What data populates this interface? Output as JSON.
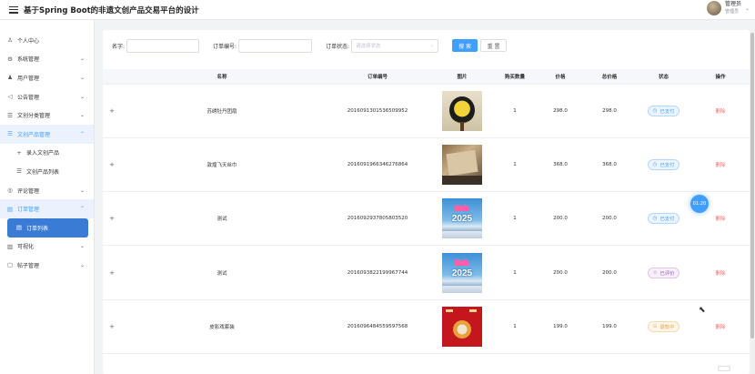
{
  "header": {
    "title": "基于Spring Boot的非遗文创产品交易平台的设计",
    "user_name": "管理员",
    "user_role": "管理员",
    "menu_icon": "hamburger-icon",
    "caret_icon": "chevron-down-icon"
  },
  "sidebar": {
    "items": [
      {
        "label": "个人中心",
        "icon": "user-icon",
        "glyph": "♙",
        "caret": ""
      },
      {
        "label": "系统管理",
        "icon": "gear-icon",
        "glyph": "⚙",
        "caret": "⌄"
      },
      {
        "label": "用户管理",
        "icon": "users-icon",
        "glyph": "♟",
        "caret": "⌄"
      },
      {
        "label": "公告管理",
        "icon": "megaphone-icon",
        "glyph": "◁",
        "caret": "⌄"
      },
      {
        "label": "文创分类管理",
        "icon": "list-icon",
        "glyph": "☰",
        "caret": "⌄"
      },
      {
        "label": "文创产品管理",
        "icon": "list-icon",
        "glyph": "☰",
        "caret": "⌃",
        "open": true
      },
      {
        "label": "录入文创产品",
        "icon": "plus-icon",
        "glyph": "+",
        "caret": "",
        "sub": true
      },
      {
        "label": "文创产品列表",
        "icon": "list-icon",
        "glyph": "☰",
        "caret": "",
        "sub": true
      },
      {
        "label": "评论管理",
        "icon": "comment-icon",
        "glyph": "◎",
        "caret": "⌄"
      },
      {
        "label": "订单管理",
        "icon": "document-icon",
        "glyph": "▤",
        "caret": "⌃",
        "open": true
      },
      {
        "label": "订单列表",
        "icon": "document-icon",
        "glyph": "▤",
        "caret": "",
        "sub": true,
        "active": true
      },
      {
        "label": "可视化",
        "icon": "chart-icon",
        "glyph": "▥",
        "caret": "⌄"
      },
      {
        "label": "帖子管理",
        "icon": "post-icon",
        "glyph": "▢",
        "caret": "⌄"
      }
    ]
  },
  "search": {
    "name_label": "名字:",
    "name_value": "",
    "order_no_label": "订单编号:",
    "order_no_value": "",
    "status_label": "订单状态:",
    "status_placeholder": "请选择状态",
    "search_button": "搜 索",
    "reset_button": "重 置"
  },
  "table": {
    "columns": [
      "",
      "名称",
      "订单编号",
      "图片",
      "购买数量",
      "价格",
      "总价格",
      "状态",
      "操作"
    ],
    "rows": [
      {
        "expand": "+",
        "name": "苏绣牡丹团扇",
        "order_no": "2016091301536509952",
        "image": "fan-photo",
        "qty": "1",
        "price": "298.0",
        "total": "298.0",
        "status": "已支付",
        "status_icon": "clock-icon",
        "status_glyph": "◷",
        "status_color": "#409eff",
        "status_bg": "#ecf5ff",
        "status_border": "#b3d8ff",
        "action": "删除"
      },
      {
        "expand": "+",
        "name": "敦煌飞天丝巾",
        "order_no": "2016091966346276864",
        "image": "scarf-photo",
        "qty": "1",
        "price": "368.0",
        "total": "368.0",
        "status": "已支付",
        "status_icon": "clock-icon",
        "status_glyph": "◷",
        "status_color": "#409eff",
        "status_bg": "#ecf5ff",
        "status_border": "#b3d8ff",
        "action": "删除"
      },
      {
        "expand": "+",
        "name": "测试",
        "order_no": "2016092937805803520",
        "image": "2025-photo",
        "qty": "1",
        "price": "200.0",
        "total": "200.0",
        "status": "已支付",
        "status_icon": "clock-icon",
        "status_glyph": "◷",
        "status_color": "#409eff",
        "status_bg": "#ecf5ff",
        "status_border": "#b3d8ff",
        "action": "删除"
      },
      {
        "expand": "+",
        "name": "测试",
        "order_no": "2016093822199967744",
        "image": "2025-photo",
        "qty": "1",
        "price": "200.0",
        "total": "200.0",
        "status": "已评价",
        "status_icon": "star-icon",
        "status_glyph": "☆",
        "status_color": "#9b59b6",
        "status_bg": "#f7f0fb",
        "status_border": "#dcc6ea",
        "action": "删除"
      },
      {
        "expand": "+",
        "name": "皮影戏套装",
        "order_no": "2016096484559597568",
        "image": "shadow-puppet-photo",
        "qty": "1",
        "price": "199.0",
        "total": "199.0",
        "status": "退款中",
        "status_icon": "refund-icon",
        "status_glyph": "⊙",
        "status_color": "#e6a23c",
        "status_bg": "#fdf6ec",
        "status_border": "#f5dab1",
        "action": "删除"
      }
    ]
  },
  "float_badge": "01:20"
}
